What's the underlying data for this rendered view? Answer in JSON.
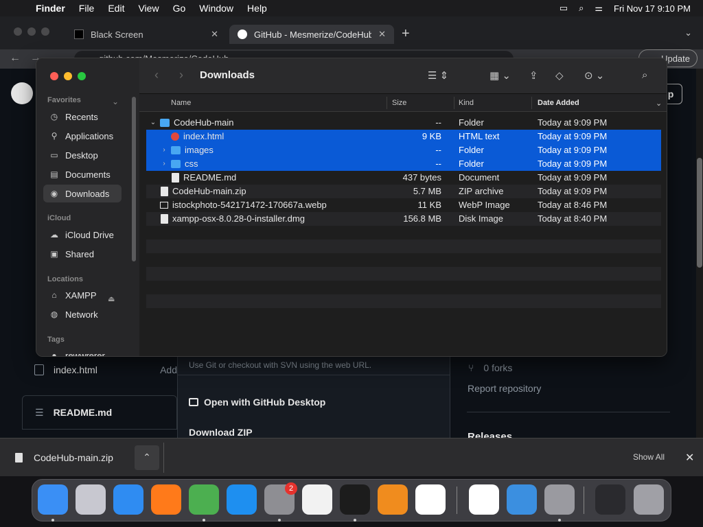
{
  "menubar": {
    "apple": "",
    "app": "Finder",
    "menus": [
      "File",
      "Edit",
      "View",
      "Go",
      "Window",
      "Help"
    ],
    "datetime": "Fri Nov 17  9:10 PM"
  },
  "browser": {
    "tabs": [
      {
        "title": "Black Screen"
      },
      {
        "title": "GitHub - Mesmerize/CodeHub"
      }
    ],
    "url": "github.com/Mesmerize/CodeHub",
    "update_label": "Update"
  },
  "github": {
    "signup_label": "p",
    "files": [
      {
        "name": "index.html",
        "trail": "Add"
      }
    ],
    "readme_label": "README.md",
    "clone_hint": "Use Git or checkout with SVN using the web URL.",
    "open_desktop": "Open with GitHub Desktop",
    "download_zip": "Download ZIP",
    "forks": "0 forks",
    "report": "Report repository",
    "releases": "Releases"
  },
  "finder": {
    "title": "Downloads",
    "sidebar": {
      "favorites_label": "Favorites",
      "favorites": [
        {
          "label": "Recents",
          "icon": "clock-icon"
        },
        {
          "label": "Applications",
          "icon": "applications-icon"
        },
        {
          "label": "Desktop",
          "icon": "desktop-icon"
        },
        {
          "label": "Documents",
          "icon": "document-icon"
        },
        {
          "label": "Downloads",
          "icon": "downloads-icon",
          "active": true
        }
      ],
      "icloud_label": "iCloud",
      "icloud": [
        {
          "label": "iCloud Drive",
          "icon": "cloud-icon"
        },
        {
          "label": "Shared",
          "icon": "shared-folder-icon"
        }
      ],
      "locations_label": "Locations",
      "locations": [
        {
          "label": "XAMPP",
          "icon": "drive-icon"
        },
        {
          "label": "Network",
          "icon": "globe-icon"
        }
      ],
      "tags_label": "Tags",
      "tags": [
        {
          "label": "rewwrerer"
        }
      ]
    },
    "columns": {
      "name": "Name",
      "size": "Size",
      "kind": "Kind",
      "date": "Date Added"
    },
    "rows": [
      {
        "name": "CodeHub-main",
        "size": "--",
        "kind": "Folder",
        "date": "Today at 9:09 PM",
        "icon": "folder-icon",
        "indent": 0,
        "disclosure": "down",
        "selected": false
      },
      {
        "name": "index.html",
        "size": "9 KB",
        "kind": "HTML text",
        "date": "Today at 9:09 PM",
        "icon": "html-file-icon",
        "indent": 1,
        "disclosure": "none",
        "selected": true
      },
      {
        "name": "images",
        "size": "--",
        "kind": "Folder",
        "date": "Today at 9:09 PM",
        "icon": "folder-icon",
        "indent": 1,
        "disclosure": "right",
        "selected": true
      },
      {
        "name": "css",
        "size": "--",
        "kind": "Folder",
        "date": "Today at 9:09 PM",
        "icon": "folder-icon",
        "indent": 1,
        "disclosure": "right",
        "selected": true
      },
      {
        "name": "README.md",
        "size": "437 bytes",
        "kind": "Document",
        "date": "Today at 9:09 PM",
        "icon": "markdown-file-icon",
        "indent": 1,
        "disclosure": "none",
        "selected": false
      },
      {
        "name": "CodeHub-main.zip",
        "size": "5.7 MB",
        "kind": "ZIP archive",
        "date": "Today at 9:09 PM",
        "icon": "zip-file-icon",
        "indent": 0,
        "disclosure": "none",
        "selected": false
      },
      {
        "name": "istockphoto-542171472-170667a.webp",
        "size": "11 KB",
        "kind": "WebP Image",
        "date": "Today at 8:46 PM",
        "icon": "image-file-icon",
        "indent": 0,
        "disclosure": "none",
        "selected": false
      },
      {
        "name": "xampp-osx-8.0.28-0-installer.dmg",
        "size": "156.8 MB",
        "kind": "Disk Image",
        "date": "Today at 8:40 PM",
        "icon": "disk-image-icon",
        "indent": 0,
        "disclosure": "none",
        "selected": false
      }
    ],
    "colors": {
      "selection": "#0a5ad6",
      "folder": "#48a7f2"
    }
  },
  "download_bar": {
    "file": "CodeHub-main.zip",
    "show_all": "Show All"
  },
  "dock": {
    "items": [
      {
        "name": "finder",
        "color": "#3a8ff5",
        "running": true
      },
      {
        "name": "launchpad",
        "color": "#c8c8d0",
        "running": false
      },
      {
        "name": "safari",
        "color": "#2f8cf2",
        "running": false
      },
      {
        "name": "firefox",
        "color": "#ff7a1a",
        "running": false
      },
      {
        "name": "chrome",
        "color": "#4caf50",
        "running": true
      },
      {
        "name": "app-store",
        "color": "#1e8ff0",
        "running": false
      },
      {
        "name": "system-settings",
        "color": "#8e8e93",
        "running": true,
        "badge": "2"
      },
      {
        "name": "textedit",
        "color": "#f2f2f2",
        "running": false
      },
      {
        "name": "terminal",
        "color": "#1c1c1c",
        "running": true
      },
      {
        "name": "garageband",
        "color": "#f08c1e",
        "running": false
      },
      {
        "name": "vscode",
        "color": "#ffffff",
        "running": false
      },
      {
        "name": "visual-studio",
        "color": "#ffffff",
        "running": false
      },
      {
        "name": "weather",
        "color": "#3b8fe0",
        "running": false
      },
      {
        "name": "system-preferences",
        "color": "#9a9aa0",
        "running": true
      },
      {
        "name": "finder-window",
        "color": "#2a2a2e",
        "running": false
      },
      {
        "name": "trash",
        "color": "#a0a0a6",
        "running": false
      }
    ]
  }
}
